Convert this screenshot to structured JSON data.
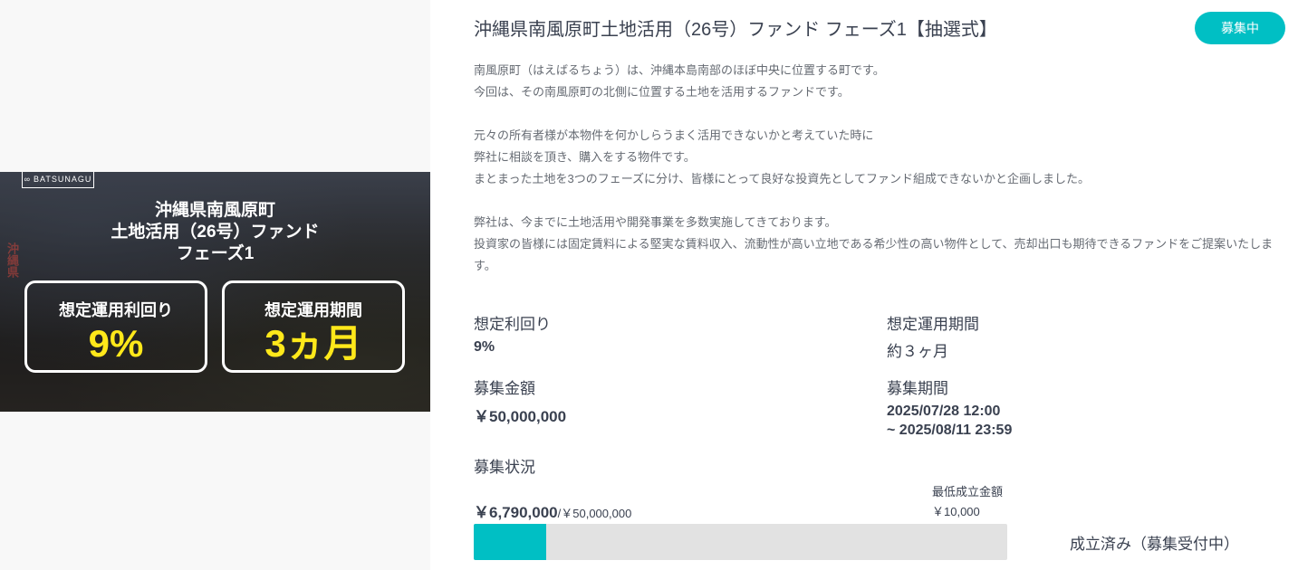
{
  "banner": {
    "brand": "BATSUNAGU",
    "title_lines": [
      "沖縄県南風原町",
      "土地活用（26号）ファンド",
      "フェーズ1"
    ],
    "metrics": [
      {
        "label": "想定運用利回り",
        "value": "9%"
      },
      {
        "label": "想定運用期間",
        "value": "3ヵ月"
      }
    ]
  },
  "fund": {
    "title": "沖縄県南風原町土地活用（26号）ファンド フェーズ1【抽選式】",
    "status": "募集中"
  },
  "description": [
    "南風原町（はえばるちょう）は、沖縄本島南部のほぼ中央に位置する町です。",
    "今回は、その南風原町の北側に位置する土地を活用するファンドです。",
    "",
    "元々の所有者様が本物件を何かしらうまく活用できないかと考えていた時に",
    "弊社に相談を頂き、購入をする物件です。",
    "まとまった土地を3つのフェーズに分け、皆様にとって良好な投資先としてファンド組成できないかと企画しました。",
    "",
    "弊社は、今までに土地活用や開発事業を多数実施してきております。",
    "投資家の皆様には固定賃料による堅実な賃料収入、流動性が高い立地である希少性の高い物件として、売却出口も期待できるファンドをご提案いたします。"
  ],
  "info": {
    "yield_label": "想定利回り",
    "yield_value": "9%",
    "period_label": "想定運用期間",
    "period_value": "約３ヶ月",
    "amount_label": "募集金額",
    "amount_value": "￥50,000,000",
    "recruit_period_label": "募集期間",
    "recruit_period_start": "2025/07/28 12:00",
    "recruit_period_end": "~ 2025/08/11 23:59"
  },
  "status_section": {
    "label": "募集状況",
    "raised": "￥6,790,000",
    "total": "/￥50,000,000",
    "min_label": "最低成立金額",
    "min_value": "￥10,000",
    "progress_fraction": 0.1358,
    "success_text": "成立済み（募集受付中）"
  },
  "colors": {
    "accent": "#00bfc4",
    "banner_highlight": "#ffe81a"
  }
}
